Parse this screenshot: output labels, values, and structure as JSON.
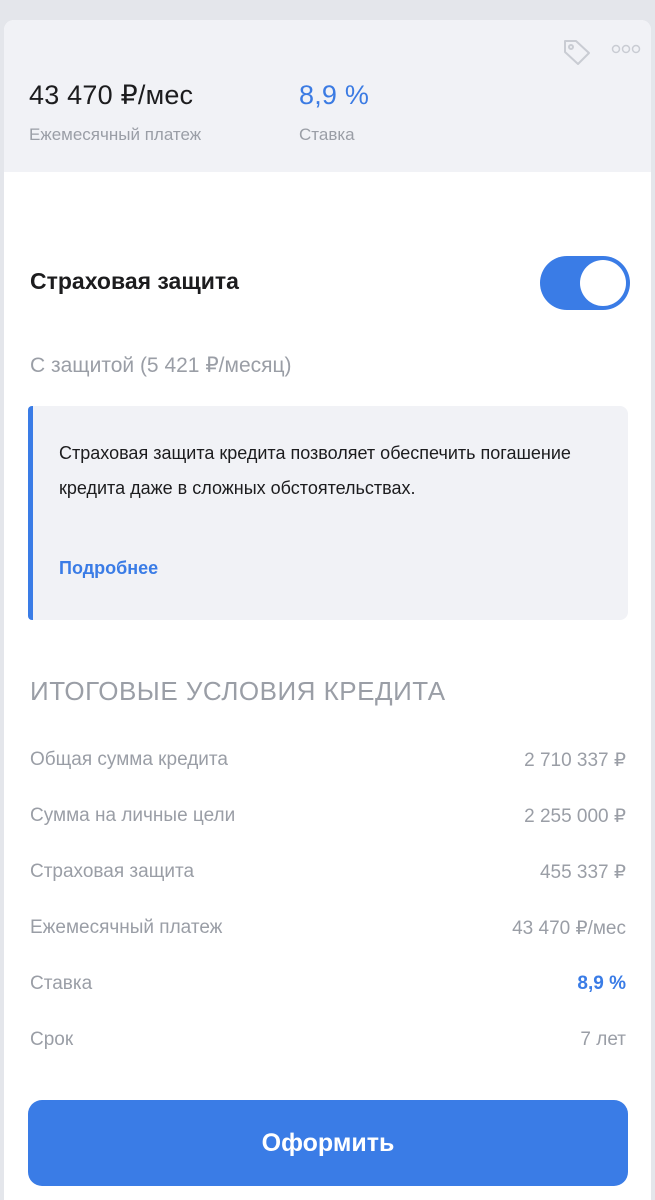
{
  "summary": {
    "monthly_payment": "43 470 ₽/мес",
    "monthly_payment_label": "Ежемесячный платеж",
    "rate": "8,9 %",
    "rate_label": "Ставка"
  },
  "insurance": {
    "title": "Страховая защита",
    "toggle_on": true,
    "subtitle": "С защитой (5 421 ₽/месяц)",
    "info_text": "Страховая защита кредита позволяет обеспечить погашение кредита даже в сложных обстоятельствах.",
    "info_link": "Подробнее"
  },
  "terms": {
    "heading": "ИТОГОВЫЕ УСЛОВИЯ КРЕДИТА",
    "rows": [
      {
        "label": "Общая сумма кредита",
        "value": "2 710 337 ₽"
      },
      {
        "label": "Сумма на личные цели",
        "value": "2 255 000 ₽"
      },
      {
        "label": "Страховая защита",
        "value": "455 337 ₽"
      },
      {
        "label": "Ежемесячный платеж",
        "value": "43 470 ₽/мес"
      },
      {
        "label": "Ставка",
        "value": "8,9 %"
      },
      {
        "label": "Срок",
        "value": "7 лет"
      }
    ]
  },
  "action": {
    "submit_label": "Оформить"
  },
  "icons": {
    "tag": "tag-icon",
    "more": "more-dots-icon"
  },
  "colors": {
    "accent": "#3a7ce6",
    "muted": "#9a9ea6",
    "panel": "#f1f2f6"
  }
}
